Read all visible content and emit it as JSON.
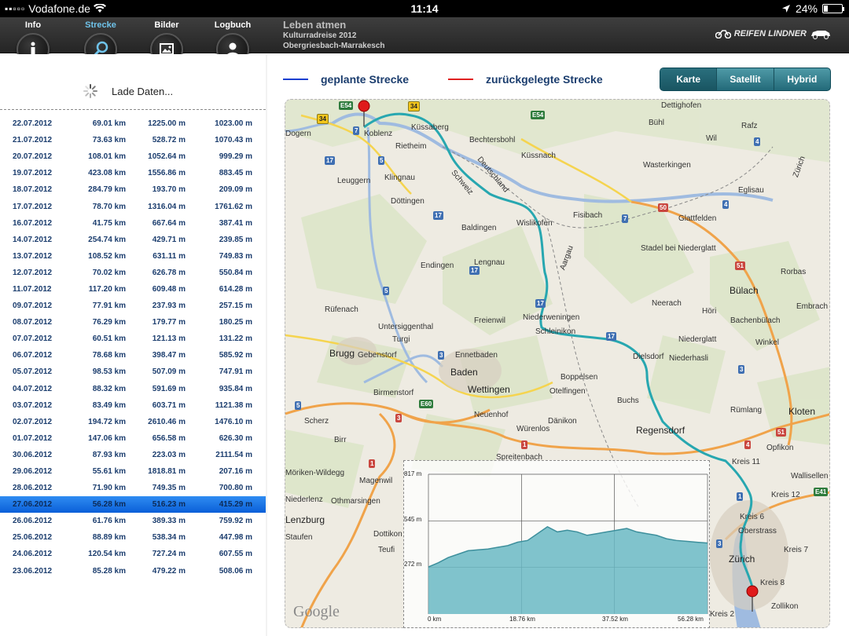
{
  "status": {
    "carrier": "Vodafone.de",
    "time": "11:14",
    "battery": "24%",
    "battery_level": 0.24
  },
  "tabs": [
    {
      "label": "Info"
    },
    {
      "label": "Strecke"
    },
    {
      "label": "Bilder"
    },
    {
      "label": "Logbuch"
    }
  ],
  "header": {
    "title": "Leben atmen",
    "subtitle1": "Kulturradreise 2012",
    "subtitle2": "Obergriesbach-Marrakesch",
    "brand": "REIFEN LINDNER"
  },
  "loading_text": "Lade Daten...",
  "rows": [
    [
      "22.07.2012",
      "69.01 km",
      "1225.00 m",
      "1023.00 m"
    ],
    [
      "21.07.2012",
      "73.63 km",
      "528.72 m",
      "1070.43 m"
    ],
    [
      "20.07.2012",
      "108.01 km",
      "1052.64 m",
      "999.29 m"
    ],
    [
      "19.07.2012",
      "423.08 km",
      "1556.86 m",
      "883.45 m"
    ],
    [
      "18.07.2012",
      "284.79 km",
      "193.70 m",
      "209.09 m"
    ],
    [
      "17.07.2012",
      "78.70 km",
      "1316.04 m",
      "1761.62 m"
    ],
    [
      "16.07.2012",
      "41.75 km",
      "667.64 m",
      "387.41 m"
    ],
    [
      "14.07.2012",
      "254.74 km",
      "429.71 m",
      "239.85 m"
    ],
    [
      "13.07.2012",
      "108.52 km",
      "631.11 m",
      "749.83 m"
    ],
    [
      "12.07.2012",
      "70.02 km",
      "626.78 m",
      "550.84 m"
    ],
    [
      "11.07.2012",
      "117.20 km",
      "609.48 m",
      "614.28 m"
    ],
    [
      "09.07.2012",
      "77.91 km",
      "237.93 m",
      "257.15 m"
    ],
    [
      "08.07.2012",
      "76.29 km",
      "179.77 m",
      "180.25 m"
    ],
    [
      "07.07.2012",
      "60.51 km",
      "121.13 m",
      "131.22 m"
    ],
    [
      "06.07.2012",
      "78.68 km",
      "398.47 m",
      "585.92 m"
    ],
    [
      "05.07.2012",
      "98.53 km",
      "507.09 m",
      "747.91 m"
    ],
    [
      "04.07.2012",
      "88.32 km",
      "591.69 m",
      "935.84 m"
    ],
    [
      "03.07.2012",
      "83.49 km",
      "603.71 m",
      "1121.38 m"
    ],
    [
      "02.07.2012",
      "194.72 km",
      "2610.46 m",
      "1476.10 m"
    ],
    [
      "01.07.2012",
      "147.06 km",
      "656.58 m",
      "626.30 m"
    ],
    [
      "30.06.2012",
      "87.93 km",
      "223.03 m",
      "2111.54 m"
    ],
    [
      "29.06.2012",
      "55.61 km",
      "1818.81 m",
      "207.16 m"
    ],
    [
      "28.06.2012",
      "71.90 km",
      "749.35 m",
      "700.80 m"
    ],
    [
      "27.06.2012",
      "56.28 km",
      "516.23 m",
      "415.29 m"
    ],
    [
      "26.06.2012",
      "61.76 km",
      "389.33 m",
      "759.92 m"
    ],
    [
      "25.06.2012",
      "88.89 km",
      "538.34 m",
      "447.98 m"
    ],
    [
      "24.06.2012",
      "120.54 km",
      "727.24 m",
      "607.55 m"
    ],
    [
      "23.06.2012",
      "85.28 km",
      "479.22 m",
      "508.06 m"
    ]
  ],
  "selected_row": "27.06.2012",
  "legend": {
    "planned": "geplante Strecke",
    "travelled": "zurückgelegte Strecke",
    "planned_color": "#1a3fd0",
    "travelled_color": "#e02020"
  },
  "map_types": [
    "Karte",
    "Satellit",
    "Hybrid"
  ],
  "map_type_selected": "Karte",
  "map": {
    "provider": "Google",
    "route_color": "#27a7b0",
    "places": [
      "Koblenz",
      "Küssaberg",
      "Dettighofen",
      "Rafz",
      "Bühl",
      "Wil",
      "Bechtersbohl",
      "Küssnach",
      "Rietheim",
      "Dogern",
      "Leuggern",
      "Klingnau",
      "Wasterkingen",
      "Eglisau",
      "Döttingen",
      "Fisibach",
      "Glattfelden",
      "Baldingen",
      "Wislikofen",
      "Endingen",
      "Lengnau",
      "Stadel bei Niederglatt",
      "Bülach",
      "Rorbas",
      "Embrach",
      "Neerach",
      "Höri",
      "Bachenbülach",
      "Rüfenach",
      "Untersiggenthal",
      "Freienwil",
      "Niederweningen",
      "Schleinikon",
      "Niederglatt",
      "Winkel",
      "Turgi",
      "Brugg",
      "Gebenstorf",
      "Ennetbaden",
      "Baden",
      "Wettingen",
      "Dielsdorf",
      "Niederhasli",
      "Boppelsen",
      "Otelfingen",
      "Birmenstorf",
      "Buchs",
      "Rümlang",
      "Kloten",
      "Scherz",
      "Neuenhof",
      "Dänikon",
      "Würenlos",
      "Regensdorf",
      "Opfikon",
      "Wallisellen",
      "Birr",
      "Möriken-Wildegg",
      "Magenwil",
      "Niederlenz",
      "Othmarsingen",
      "Lenzburg",
      "Staufen",
      "Dottikon",
      "Teufi",
      "Kreis 11",
      "Kreis 12",
      "Kreis 6",
      "Oberstrass",
      "Kreis 7",
      "Zürich",
      "Kreis 8",
      "Zollikon",
      "Kreis 2",
      "Deutschland",
      "Schweiz",
      "Aargau",
      "Zürich",
      "Spreitenbach"
    ],
    "road_labels": [
      "E54",
      "34",
      "E54",
      "34",
      "7",
      "5",
      "17",
      "4",
      "50",
      "4",
      "7",
      "17",
      "17",
      "51",
      "5",
      "3",
      "17",
      "17",
      "3",
      "E60",
      "5",
      "3",
      "1",
      "1",
      "51",
      "4",
      "E41",
      "1",
      "3"
    ]
  },
  "chart_data": {
    "type": "area",
    "title": "",
    "xlabel": "",
    "ylabel": "",
    "x_ticks": [
      "0 km",
      "18.76 km",
      "37.52 km",
      "56.28 km"
    ],
    "y_ticks": [
      "817 m",
      "545 m",
      "272 m"
    ],
    "xlim": [
      0,
      56.28
    ],
    "ylim": [
      0,
      817
    ],
    "x": [
      0,
      2,
      4,
      6,
      8,
      10,
      12,
      14,
      16,
      18,
      20,
      22,
      24,
      26,
      28,
      30,
      32,
      34,
      36,
      38,
      40,
      42,
      44,
      46,
      48,
      50,
      52,
      54,
      56.28
    ],
    "y": [
      275,
      300,
      330,
      350,
      370,
      375,
      380,
      390,
      400,
      420,
      430,
      470,
      510,
      480,
      490,
      480,
      460,
      470,
      480,
      490,
      500,
      480,
      470,
      460,
      440,
      430,
      425,
      420,
      415
    ],
    "color": "#6ab8c4"
  }
}
